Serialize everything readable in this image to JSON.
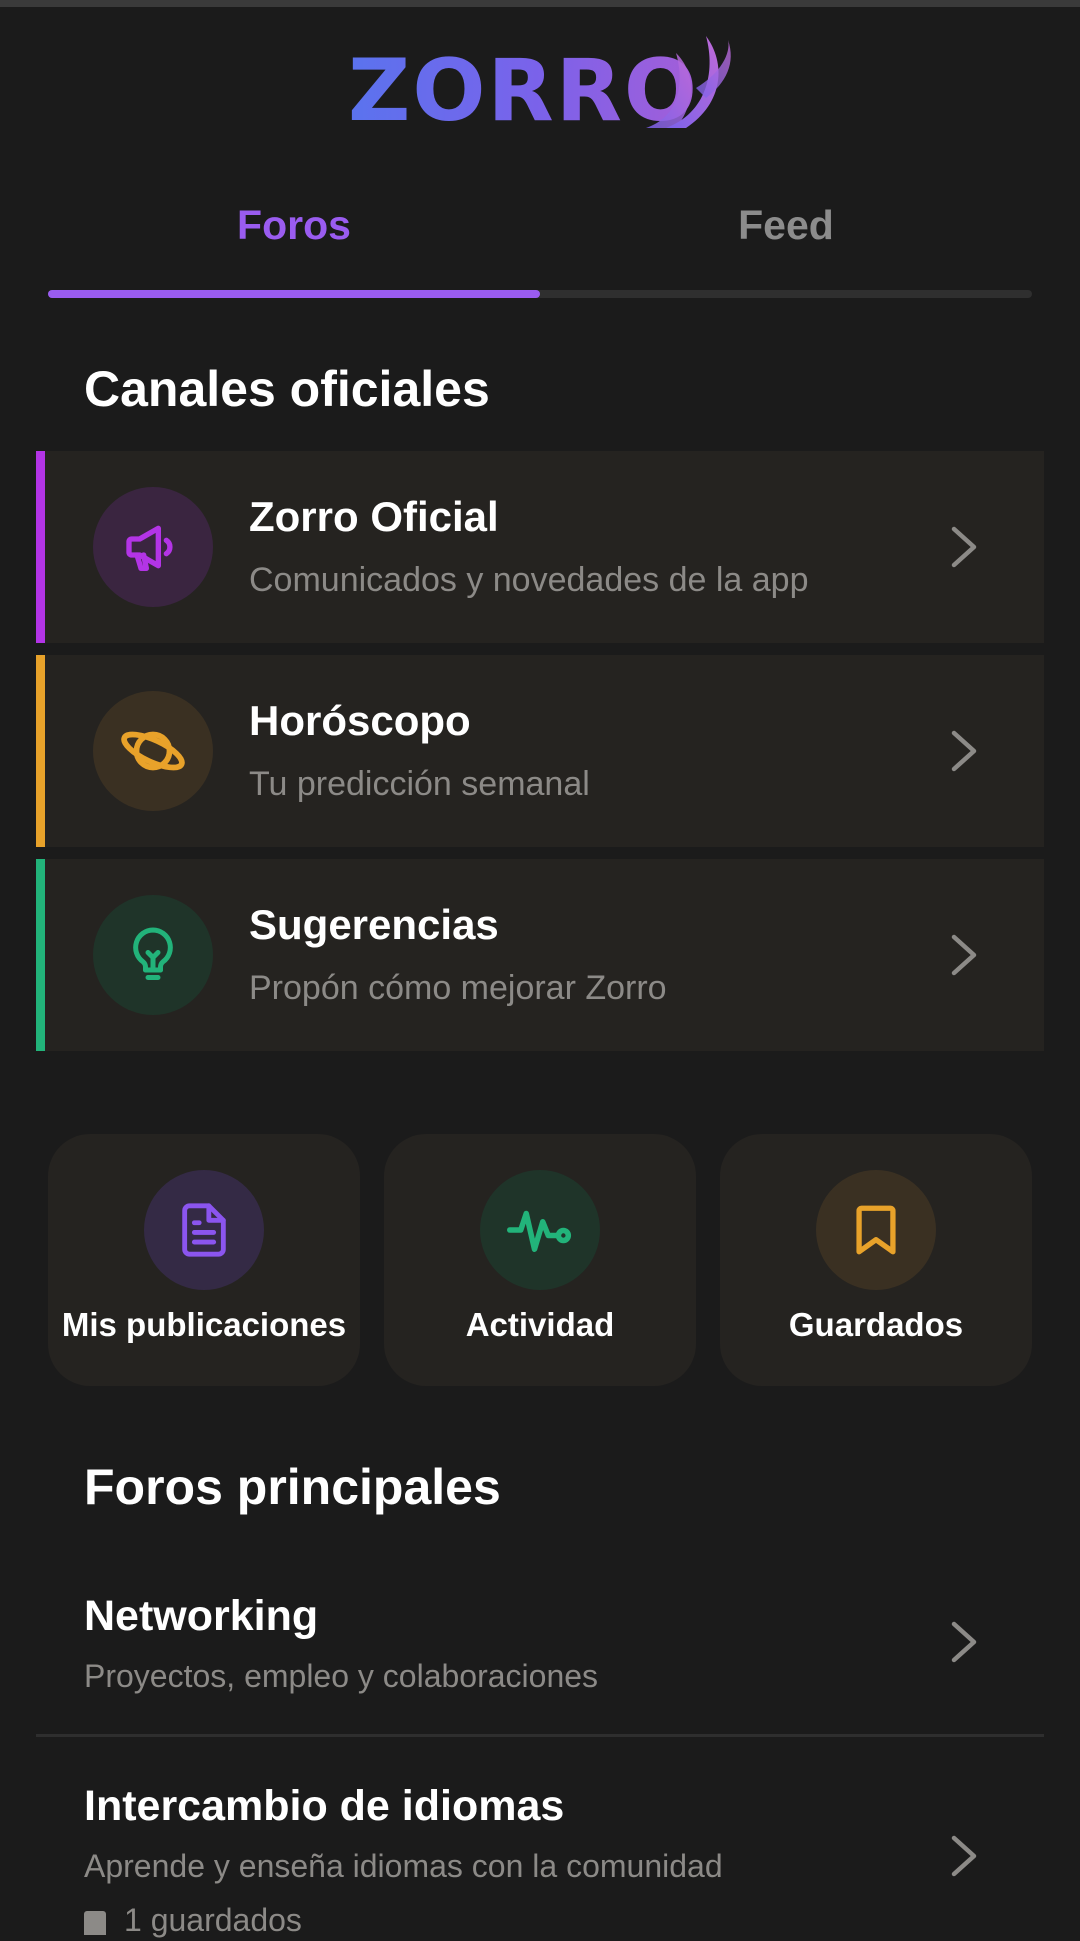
{
  "app": {
    "logo_text": "ZORRO"
  },
  "tabs": [
    {
      "label": "Foros",
      "active": true
    },
    {
      "label": "Feed",
      "active": false
    }
  ],
  "official": {
    "title": "Canales oficiales",
    "channels": [
      {
        "title": "Zorro Oficial",
        "subtitle": "Comunicados y novedades de la app",
        "icon": "megaphone-icon",
        "color": "#b334e6"
      },
      {
        "title": "Horóscopo",
        "subtitle": "Tu predicción semanal",
        "icon": "planet-icon",
        "color": "#e8a22a"
      },
      {
        "title": "Sugerencias",
        "subtitle": "Propón cómo mejorar Zorro",
        "icon": "lightbulb-icon",
        "color": "#22b37a"
      }
    ]
  },
  "quick_actions": [
    {
      "label": "Mis publicaciones",
      "icon": "document-icon",
      "color": "#8b55ef"
    },
    {
      "label": "Actividad",
      "icon": "activity-icon",
      "color": "#22b37a"
    },
    {
      "label": "Guardados",
      "icon": "bookmark-icon",
      "color": "#e8a22a"
    }
  ],
  "main_forums": {
    "title": "Foros principales",
    "items": [
      {
        "title": "Networking",
        "subtitle": "Proyectos, empleo y colaboraciones"
      },
      {
        "title": "Intercambio de idiomas",
        "subtitle": "Aprende y enseña idiomas con la comunidad",
        "meta": "1 guardados"
      }
    ]
  }
}
